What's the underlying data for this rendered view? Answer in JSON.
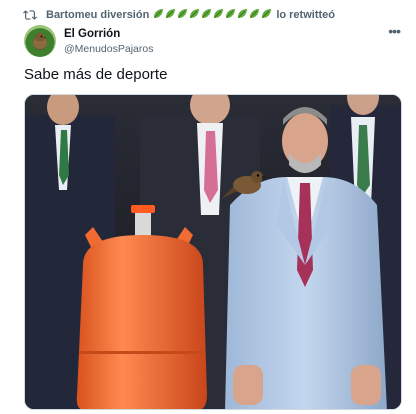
{
  "retweet": {
    "user": "Bartomeu diversión",
    "suffix": "lo retwitteó",
    "icon": "retweet-icon",
    "emoji_count": 10
  },
  "tweet": {
    "display_name": "El Gorrión",
    "handle": "@MenudosPajaros",
    "text": "Sabe más de deporte",
    "more_icon": "more-options-icon"
  },
  "colors": {
    "accent": "#536471",
    "leaf": "#5fa83a",
    "gas_bottle": "#f26b32"
  }
}
